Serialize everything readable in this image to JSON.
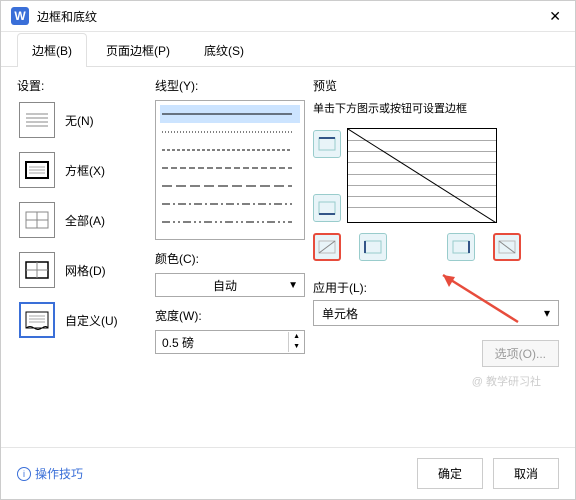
{
  "window": {
    "logo": "W",
    "title": "边框和底纹"
  },
  "tabs": [
    {
      "label": "边框(B)",
      "active": true
    },
    {
      "label": "页面边框(P)",
      "active": false
    },
    {
      "label": "底纹(S)",
      "active": false
    }
  ],
  "settings": {
    "label": "设置:",
    "items": [
      {
        "key": "none",
        "label": "无(N)"
      },
      {
        "key": "box",
        "label": "方框(X)"
      },
      {
        "key": "all",
        "label": "全部(A)"
      },
      {
        "key": "grid",
        "label": "网格(D)"
      },
      {
        "key": "custom",
        "label": "自定义(U)",
        "selected": true
      }
    ]
  },
  "style": {
    "line_label": "线型(Y):",
    "color_label": "颜色(C):",
    "color_value": "自动",
    "width_label": "宽度(W):",
    "width_value": "0.5  磅"
  },
  "preview": {
    "label": "预览",
    "hint": "单击下方图示或按钮可设置边框"
  },
  "apply": {
    "label": "应用于(L):",
    "value": "单元格",
    "options_btn": "选项(O)..."
  },
  "footer": {
    "tips": "操作技巧",
    "ok": "确定",
    "cancel": "取消"
  },
  "watermark": "@ 教学研习社"
}
